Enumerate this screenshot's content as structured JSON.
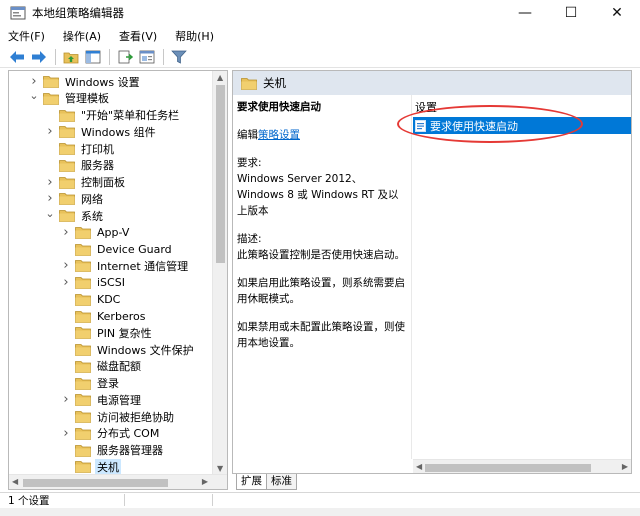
{
  "window": {
    "title": "本地组策略编辑器",
    "controls": [
      "—",
      "☐",
      "✕"
    ]
  },
  "menu": [
    "文件(F)",
    "操作(A)",
    "查看(V)",
    "帮助(H)"
  ],
  "toolbar_icons": [
    "back-arrow-icon",
    "forward-arrow-icon",
    "up-folder-icon",
    "show-hide-tree-icon",
    "export-list-icon",
    "properties-icon",
    "filter-icon"
  ],
  "tree": {
    "items": [
      {
        "label": "Windows 设置",
        "level": 1,
        "expander": "collapsed",
        "selected": false
      },
      {
        "label": "管理模板",
        "level": 1,
        "expander": "expanded",
        "selected": false
      },
      {
        "label": "\"开始\"菜单和任务栏",
        "level": 2,
        "expander": "none",
        "selected": false
      },
      {
        "label": "Windows 组件",
        "level": 2,
        "expander": "collapsed",
        "selected": false
      },
      {
        "label": "打印机",
        "level": 2,
        "expander": "none",
        "selected": false
      },
      {
        "label": "服务器",
        "level": 2,
        "expander": "none",
        "selected": false
      },
      {
        "label": "控制面板",
        "level": 2,
        "expander": "collapsed",
        "selected": false
      },
      {
        "label": "网络",
        "level": 2,
        "expander": "collapsed",
        "selected": false
      },
      {
        "label": "系统",
        "level": 2,
        "expander": "expanded",
        "selected": false
      },
      {
        "label": "App-V",
        "level": 3,
        "expander": "collapsed",
        "selected": false
      },
      {
        "label": "Device Guard",
        "level": 3,
        "expander": "none",
        "selected": false
      },
      {
        "label": "Internet 通信管理",
        "level": 3,
        "expander": "collapsed",
        "selected": false
      },
      {
        "label": "iSCSI",
        "level": 3,
        "expander": "collapsed",
        "selected": false
      },
      {
        "label": "KDC",
        "level": 3,
        "expander": "none",
        "selected": false
      },
      {
        "label": "Kerberos",
        "level": 3,
        "expander": "none",
        "selected": false
      },
      {
        "label": "PIN 复杂性",
        "level": 3,
        "expander": "none",
        "selected": false
      },
      {
        "label": "Windows 文件保护",
        "level": 3,
        "expander": "none",
        "selected": false
      },
      {
        "label": "磁盘配额",
        "level": 3,
        "expander": "none",
        "selected": false
      },
      {
        "label": "登录",
        "level": 3,
        "expander": "none",
        "selected": false
      },
      {
        "label": "电源管理",
        "level": 3,
        "expander": "collapsed",
        "selected": false
      },
      {
        "label": "访问被拒绝协助",
        "level": 3,
        "expander": "none",
        "selected": false
      },
      {
        "label": "分布式 COM",
        "level": 3,
        "expander": "collapsed",
        "selected": false
      },
      {
        "label": "服务器管理器",
        "level": 3,
        "expander": "none",
        "selected": false
      },
      {
        "label": "关机",
        "level": 3,
        "expander": "none",
        "selected": true
      }
    ]
  },
  "right_pane": {
    "header_title": "关机",
    "description": {
      "policy_title": "要求使用快速启动",
      "edit_prefix": "编辑",
      "edit_link": "策略设置",
      "requirements_label": "要求:",
      "requirements_text": "Windows Server 2012、Windows 8 或 Windows RT 及以上版本",
      "description_label": "描述:",
      "description_text": "此策略设置控制是否使用快速启动。",
      "enabled_text": "如果启用此策略设置，则系统需要启用休眠模式。",
      "disabled_text": "如果禁用或未配置此策略设置，则使用本地设置。"
    },
    "settings_header": "设置",
    "settings": [
      {
        "label": "要求使用快速启动",
        "selected": true
      }
    ]
  },
  "tabs": [
    "扩展",
    "标准"
  ],
  "status": {
    "count_text": "1 个设置"
  },
  "colors": {
    "selection": "#0078d7",
    "tree_selection": "#cce8ff",
    "header_band": "#dfe6ef",
    "annotation_oval": "#e53935",
    "folder": "#e8c15a"
  }
}
